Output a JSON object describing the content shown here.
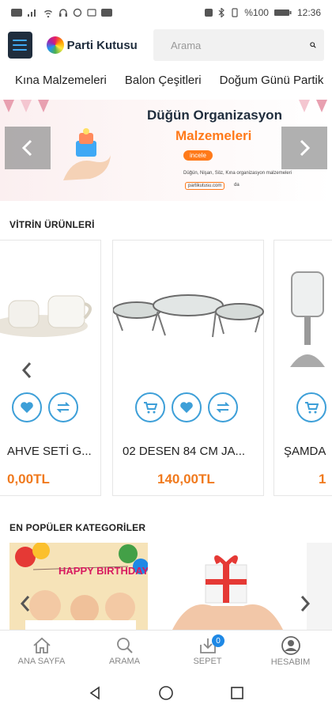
{
  "status_bar": {
    "battery": "%100",
    "time": "12:36"
  },
  "header": {
    "logo_text": "Parti Kutusu",
    "search_placeholder": "Arama"
  },
  "category_nav": [
    {
      "label": "Kına Malzemeleri"
    },
    {
      "label": "Balon Çeşitleri"
    },
    {
      "label": "Doğum Günü Partik"
    }
  ],
  "banner": {
    "title": "Düğün Organizasyon",
    "subtitle": "Malzemeleri",
    "cta": "incele",
    "description": "Düğün, Nişan, Söz, Kına organizasyon malzemeleri",
    "url": "partikutusu.com",
    "url_suffix": "da"
  },
  "showcase": {
    "title": "VİTRİN ÜRÜNLERİ",
    "products": [
      {
        "name": "AHVE SETİ G...",
        "price": "0,00TL"
      },
      {
        "name": "02 DESEN 84 CM JA...",
        "price": "140,00TL"
      },
      {
        "name": "ŞAMDA",
        "price": "1"
      }
    ]
  },
  "popular": {
    "title": "EN POPÜLER KATEGORİLER",
    "banner_text": "HAPPY BIRTHDAY"
  },
  "bottom_nav": [
    {
      "label": "ANA SAYFA",
      "icon": "home-icon"
    },
    {
      "label": "ARAMA",
      "icon": "search-icon"
    },
    {
      "label": "SEPET",
      "icon": "cart-download-icon",
      "badge": "0"
    },
    {
      "label": "HESABIM",
      "icon": "account-icon"
    }
  ],
  "colors": {
    "accent_blue": "#3d9fd8",
    "price_orange": "#f07a1e",
    "menu_dark": "#1f2d3d"
  }
}
